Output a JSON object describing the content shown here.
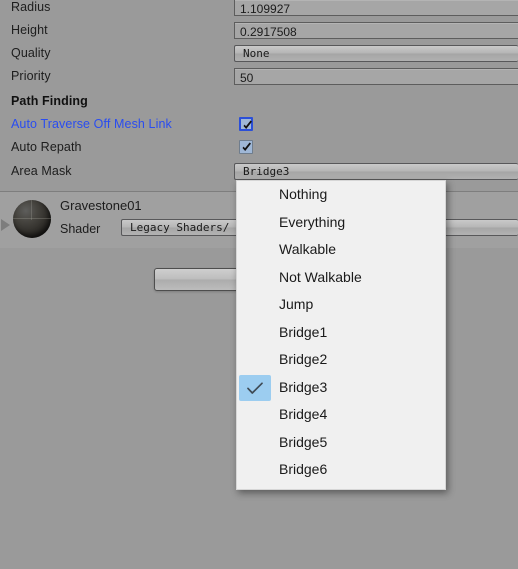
{
  "inspector": {
    "properties": [
      {
        "label": "Radius",
        "value": "1.109927",
        "control": "number"
      },
      {
        "label": "Height",
        "value": "0.2917508",
        "control": "number"
      },
      {
        "label": "Quality",
        "value": "None",
        "control": "enum"
      },
      {
        "label": "Priority",
        "value": "50",
        "control": "number"
      }
    ],
    "path_finding": {
      "header": "Path Finding",
      "auto_traverse_off_mesh_link": {
        "label": "Auto Traverse Off Mesh Link",
        "checked": true,
        "focused": true
      },
      "auto_repath": {
        "label": "Auto Repath",
        "checked": true,
        "focused": false
      },
      "area_mask": {
        "label": "Area Mask",
        "value": "Bridge3"
      }
    }
  },
  "material": {
    "name": "Gravestone01",
    "shader_label": "Shader",
    "shader_value": "Legacy Shaders/"
  },
  "area_mask_menu": {
    "items": [
      {
        "label": "Nothing",
        "checked": false
      },
      {
        "label": "Everything",
        "checked": false
      },
      {
        "label": "Walkable",
        "checked": false
      },
      {
        "label": "Not Walkable",
        "checked": false
      },
      {
        "label": "Jump",
        "checked": false
      },
      {
        "label": "Bridge1",
        "checked": false
      },
      {
        "label": "Bridge2",
        "checked": false
      },
      {
        "label": "Bridge3",
        "checked": true
      },
      {
        "label": "Bridge4",
        "checked": false
      },
      {
        "label": "Bridge5",
        "checked": false
      },
      {
        "label": "Bridge6",
        "checked": false
      }
    ]
  },
  "colors": {
    "panel_background": "#9a9a9a",
    "menu_background": "#f0f0f0",
    "selection_highlight": "#9ccdf0",
    "link_text": "#2a4df0",
    "checkbox_fill": "#9fb7d6",
    "focus_border": "#2b4fd8"
  }
}
